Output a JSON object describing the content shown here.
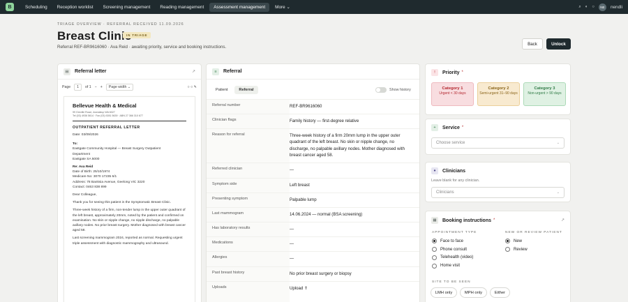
{
  "nav": {
    "logo": "B",
    "items": [
      "Scheduling",
      "Reception worklist",
      "Screening management",
      "Reading management",
      "Assessment management",
      "More ⌄"
    ],
    "active_index": 4,
    "user_initials": "NE",
    "user_name": "nendli"
  },
  "header": {
    "eyebrow": "TRIAGE OVERVIEW · REFERRAL RECEIVED 11.09.2026",
    "title": "Breast Clinic",
    "badge": "IN TRIAGE",
    "subtitle": "Referral REF-BR9616060 · Ava Reid · awaiting priority, service and booking instructions.",
    "back_label": "Back",
    "unlock_label": "Unlock"
  },
  "letter_panel": {
    "title": "Referral letter",
    "toolbar": {
      "page_label": "Page",
      "page_value": "1",
      "of_label": "of 1",
      "minus": "−",
      "plus": "+",
      "zoom": "Page width ⌄",
      "icons": "○ ○ ✎"
    },
    "doc": {
      "org": "Bellevue Health & Medical",
      "address": "99 Greville Road, Joondalup WA 6027",
      "contact": "Tel (03) 4936 5614 · Fax (03) 9281 5639 · ABN 27 366 310 677",
      "doc_title": "OUTPATIENT REFERRAL LETTER",
      "date": "Date: 03/09/2026",
      "to_label": "To:",
      "to_lines": [
        "Eastgate Community Hospital — Breast Surgery Outpatient",
        "Department",
        "Eastgate SA 5000"
      ],
      "re_label": "Re: Ava Reid",
      "re_lines": [
        "Date of Birth: 25/10/1974",
        "Medicare No: 3070 17235 6/1",
        "Address: 78 Banksia Avenue, Geelong VIC 3220",
        "Contact: 0463 838 899"
      ],
      "greeting": "Dear Colleague,",
      "para1": "Thank you for seeing this patient in the Symptomatic Breast Clinic.",
      "para2": "Three-week history of a firm, non-tender lump in the upper outer quadrant of the left breast, approximately 20mm, noted by the patient and confirmed on examination. No skin or nipple change, no nipple discharge, no palpable axillary nodes. No prior breast surgery. Mother diagnosed with breast cancer aged 58.",
      "para3": "Last screening mammogram 2024, reported as normal. Requesting urgent triple assessment with diagnostic mammography and ultrasound."
    }
  },
  "referral_panel": {
    "title": "Referral",
    "tabs": [
      "Patient",
      "Referral"
    ],
    "active_tab": 1,
    "show_history": "Show history",
    "fields": [
      {
        "label": "Referral number",
        "value": "REF-BR9616060"
      },
      {
        "label": "Clinician flags",
        "value": "Family history — first-degree relative"
      },
      {
        "label": "Reason for referral",
        "value": "Three-week history of a firm 20mm lump in the upper outer quadrant of the left breast. No skin or nipple change, no discharge, no palpable axillary nodes. Mother diagnosed with breast cancer aged 58."
      },
      {
        "label": "Referred clinician",
        "value": "—"
      },
      {
        "label": "Symptom side",
        "value": "Left breast"
      },
      {
        "label": "Presenting symptom",
        "value": "Palpable lump"
      },
      {
        "label": "Last mammogram",
        "value": "14.06.2024 — normal (BSA screening)"
      },
      {
        "label": "Has laboratory results",
        "value": "—"
      },
      {
        "label": "Medications",
        "value": "—"
      },
      {
        "label": "Allergies",
        "value": "—"
      },
      {
        "label": "Past breast history",
        "value": "No prior breast surgery or biopsy"
      },
      {
        "label": "Uploads",
        "value": "Upload ⇑"
      }
    ]
  },
  "priority": {
    "title": "Priority",
    "required": "*",
    "categories": [
      {
        "name": "Category 1",
        "desc": "Urgent < 30 days"
      },
      {
        "name": "Category 2",
        "desc": "Semi-urgent 31–90 days"
      },
      {
        "name": "Category 3",
        "desc": "Non-urgent > 90 days"
      }
    ]
  },
  "service": {
    "title": "Service",
    "required": "*",
    "placeholder": "Choose service"
  },
  "clinicians": {
    "title": "Clinicians",
    "hint": "Leave blank for any clinician.",
    "placeholder": "Clinicians"
  },
  "booking": {
    "title": "Booking instructions",
    "required": "*",
    "appointment_type_label": "APPOINTMENT TYPE",
    "appointment_types": [
      "Face to face",
      "Phone consult",
      "Telehealth (video)",
      "Home visit"
    ],
    "appointment_selected": 0,
    "patient_type_label": "NEW OR REVIEW PATIENT",
    "patient_types": [
      "New",
      "Review"
    ],
    "patient_selected": 0,
    "site_label": "SITE TO BE SEEN",
    "sites": [
      "LMH only",
      "MPH only",
      "Either"
    ]
  },
  "colors": {
    "nav_bg": "#1f2a2e",
    "cat1": "#f8dde0",
    "cat2": "#f8ead0",
    "cat3": "#dff1e3",
    "cat1_text": "#b3262e",
    "cat2_text": "#8a6418",
    "cat3_text": "#2f7a45"
  }
}
